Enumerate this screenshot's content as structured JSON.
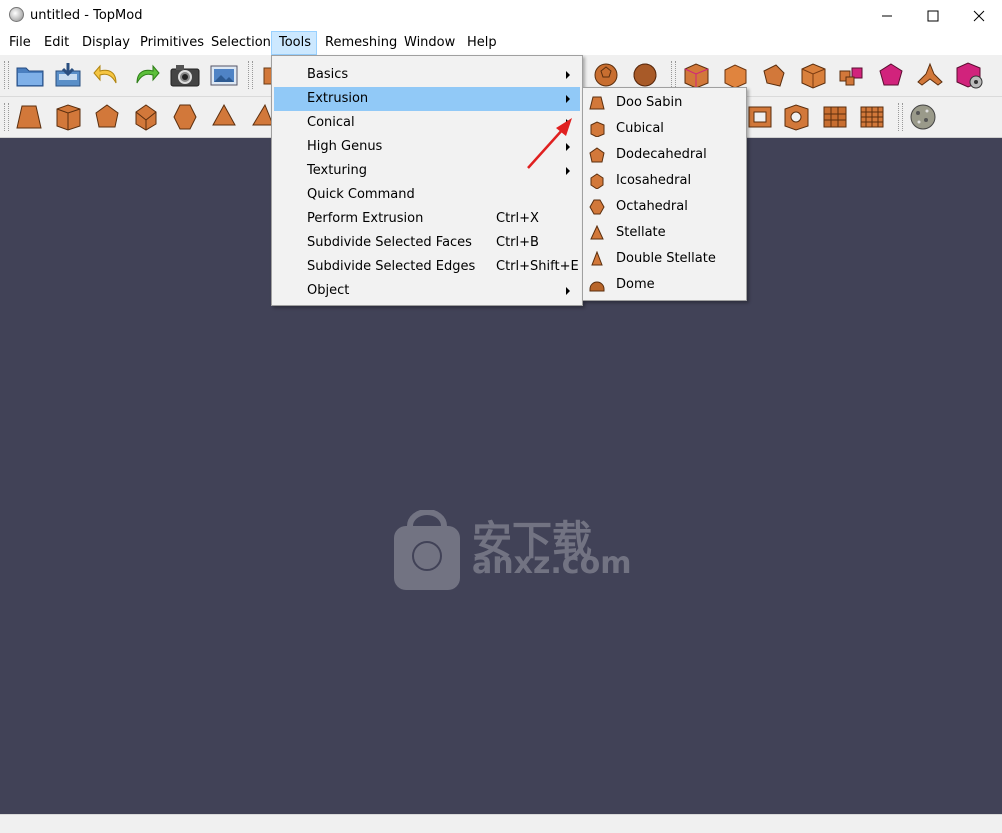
{
  "window": {
    "title": "untitled - TopMod",
    "minimize_glyph": "—",
    "maximize_glyph": "☐",
    "close_glyph": "✕"
  },
  "menubar": {
    "items": [
      "File",
      "Edit",
      "Display",
      "Primitives",
      "Selection",
      "Tools",
      "Remeshing",
      "Window",
      "Help"
    ],
    "active": "Tools"
  },
  "tools_menu": {
    "items": [
      {
        "label": "Basics",
        "shortcut": "",
        "submenu": true
      },
      {
        "label": "Extrusion",
        "shortcut": "",
        "submenu": true,
        "highlighted": true
      },
      {
        "label": "Conical",
        "shortcut": "",
        "submenu": true
      },
      {
        "label": "High Genus",
        "shortcut": "",
        "submenu": true
      },
      {
        "label": "Texturing",
        "shortcut": "",
        "submenu": true
      },
      {
        "label": "Quick Command",
        "shortcut": "",
        "submenu": false
      },
      {
        "label": "Perform Extrusion",
        "shortcut": "Ctrl+X",
        "submenu": false
      },
      {
        "label": "Subdivide Selected Faces",
        "shortcut": "Ctrl+B",
        "submenu": false
      },
      {
        "label": "Subdivide Selected Edges",
        "shortcut": "Ctrl+Shift+E",
        "submenu": false
      },
      {
        "label": "Object",
        "shortcut": "",
        "submenu": true
      }
    ]
  },
  "extrusion_menu": {
    "items": [
      "Doo Sabin",
      "Cubical",
      "Dodecahedral",
      "Icosahedral",
      "Octahedral",
      "Stellate",
      "Double Stellate",
      "Dome"
    ]
  },
  "watermark": {
    "text": "anxz.com",
    "cn_text": "安下载"
  },
  "colors": {
    "viewport": "#414257",
    "menu_highlight": "#91c9f7",
    "active_menu": "#cce8ff",
    "shape_orange": "#d2783a",
    "annotation_arrow": "#e02020"
  }
}
